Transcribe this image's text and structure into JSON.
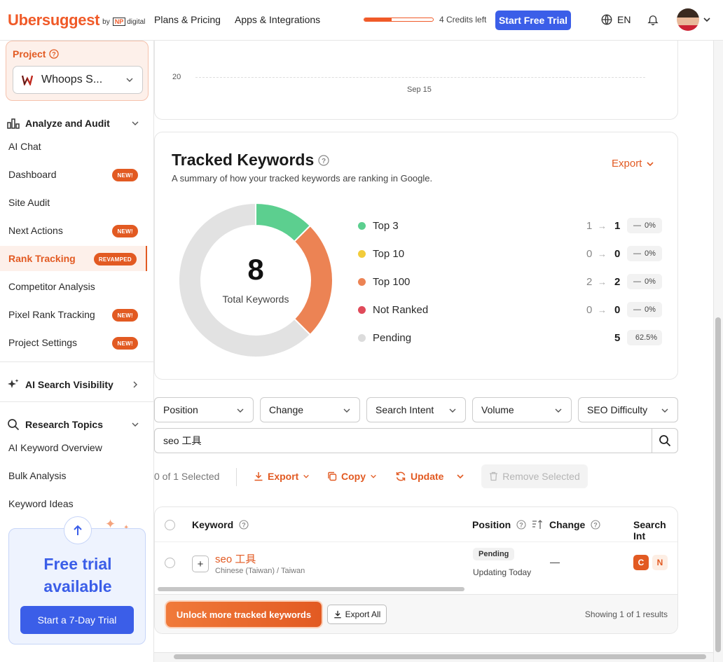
{
  "header": {
    "logo": "Ubersuggest",
    "logo_by": "by",
    "logo_np": "NP",
    "logo_digital": "digital",
    "nav": [
      "Plans & Pricing",
      "Apps & Integrations"
    ],
    "credits_fraction": 0.4,
    "credits_text": "4 Credits left",
    "trial_button": "Start Free Trial",
    "language": "EN"
  },
  "sidebar": {
    "project_label": "Project",
    "project_name": "Whoops S...",
    "section_analyze": "Analyze and Audit",
    "analyze_items": [
      {
        "label": "AI Chat",
        "badge": ""
      },
      {
        "label": "Dashboard",
        "badge": "NEW!"
      },
      {
        "label": "Site Audit",
        "badge": ""
      },
      {
        "label": "Next Actions",
        "badge": "NEW!"
      },
      {
        "label": "Rank Tracking",
        "badge": "REVAMPED"
      },
      {
        "label": "Competitor Analysis",
        "badge": ""
      },
      {
        "label": "Pixel Rank Tracking",
        "badge": "NEW!"
      },
      {
        "label": "Project Settings",
        "badge": "NEW!"
      }
    ],
    "section_ai": "AI Search Visibility",
    "section_research": "Research Topics",
    "research_items": [
      {
        "label": "AI Keyword Overview"
      },
      {
        "label": "Bulk Analysis"
      },
      {
        "label": "Keyword Ideas"
      }
    ],
    "free_title_1": "Free trial",
    "free_title_2": "available",
    "free_button": "Start a 7-Day Trial"
  },
  "chart_top": {
    "y_tick": "20",
    "x_tick": "Sep 15"
  },
  "tracked": {
    "title": "Tracked Keywords",
    "subtitle": "A summary of how your tracked keywords are ranking in Google.",
    "export": "Export",
    "total": "8",
    "total_label": "Total Keywords",
    "rows": [
      {
        "label": "Top 3",
        "color": "#5ccf8f",
        "from": "1",
        "arrow": "→",
        "to": "1",
        "dash": "—",
        "pct": "0%"
      },
      {
        "label": "Top 10",
        "color": "#f2cc3b",
        "from": "0",
        "arrow": "→",
        "to": "0",
        "dash": "—",
        "pct": "0%"
      },
      {
        "label": "Top 100",
        "color": "#ec8354",
        "from": "2",
        "arrow": "→",
        "to": "2",
        "dash": "—",
        "pct": "0%"
      },
      {
        "label": "Not Ranked",
        "color": "#e04a5a",
        "from": "0",
        "arrow": "→",
        "to": "0",
        "dash": "—",
        "pct": "0%"
      },
      {
        "label": "Pending",
        "color": "#dcdcdc",
        "from": "",
        "arrow": "",
        "to": "5",
        "dash": "",
        "pct": "62.5%"
      }
    ]
  },
  "chart_data": {
    "type": "pie",
    "categories": [
      "Top 3",
      "Top 100",
      "Pending"
    ],
    "values": [
      1,
      2,
      5
    ],
    "colors": [
      "#5ccf8f",
      "#ec8354",
      "#e2e2e2"
    ],
    "title": "Tracked Keywords"
  },
  "filters": [
    "Position",
    "Change",
    "Search Intent",
    "Volume",
    "SEO Difficulty"
  ],
  "search": {
    "value": "seo 工具"
  },
  "toolbar": {
    "selected": "0 of 1 Selected",
    "export": "Export",
    "copy": "Copy",
    "update": "Update",
    "remove": "Remove Selected"
  },
  "table": {
    "headers": [
      "Keyword",
      "Position",
      "Change",
      "Search Int"
    ],
    "row": {
      "keyword": "seo 工具",
      "lang": "Chinese (Taiwan) / Taiwan",
      "position": "Pending",
      "updating": "Updating Today",
      "change": "—",
      "intent_1": "C",
      "intent_2": "N"
    },
    "unlock": "Unlock more tracked keywords",
    "export_all": "Export All",
    "showing": "Showing 1 of 1 results"
  }
}
